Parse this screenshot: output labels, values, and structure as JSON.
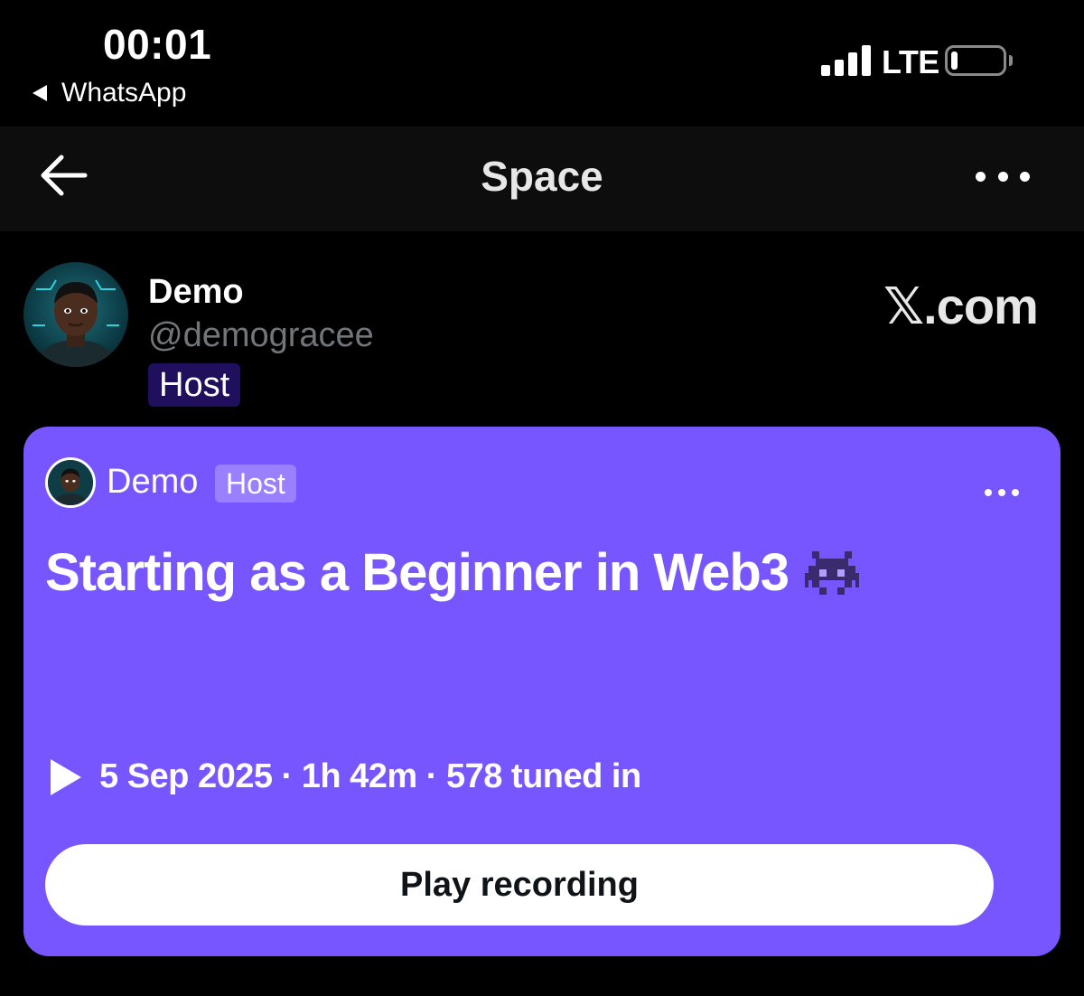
{
  "status_bar": {
    "time": "00:01",
    "back_app": "WhatsApp",
    "network": "LTE",
    "battery_level_fraction": 0.12,
    "signal_bars": 4
  },
  "nav": {
    "title": "Space",
    "back_icon": "arrow-left-icon",
    "more_icon": "more-horizontal-icon"
  },
  "host": {
    "name": "Demo",
    "handle": "@demogracee",
    "role": "Host"
  },
  "brand": {
    "logo": "𝕏.com"
  },
  "space": {
    "host_name": "Demo",
    "host_role": "Host",
    "title": "Starting as a Beginner in Web3",
    "title_emoji_icon": "alien-monster-icon",
    "meta": "5 Sep 2025 · 1h 42m · 578 tuned in",
    "play_label": "Play recording",
    "colors": {
      "card_background": "#7856ff",
      "badge_background": "#9a80ff"
    }
  }
}
